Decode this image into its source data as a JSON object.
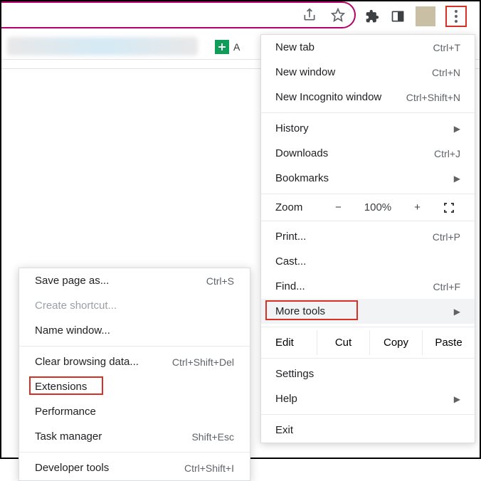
{
  "toolbar": {
    "tab_partial_label": "A"
  },
  "main_menu": {
    "new_tab": "New tab",
    "new_tab_sc": "Ctrl+T",
    "new_window": "New window",
    "new_window_sc": "Ctrl+N",
    "incognito": "New Incognito window",
    "incognito_sc": "Ctrl+Shift+N",
    "history": "History",
    "downloads": "Downloads",
    "downloads_sc": "Ctrl+J",
    "bookmarks": "Bookmarks",
    "zoom_label": "Zoom",
    "zoom_value": "100%",
    "print": "Print...",
    "print_sc": "Ctrl+P",
    "cast": "Cast...",
    "find": "Find...",
    "find_sc": "Ctrl+F",
    "more_tools": "More tools",
    "edit": "Edit",
    "cut": "Cut",
    "copy": "Copy",
    "paste": "Paste",
    "settings": "Settings",
    "help": "Help",
    "exit": "Exit"
  },
  "sub_menu": {
    "save_page": "Save page as...",
    "save_page_sc": "Ctrl+S",
    "create_shortcut": "Create shortcut...",
    "name_window": "Name window...",
    "clear_data": "Clear browsing data...",
    "clear_data_sc": "Ctrl+Shift+Del",
    "extensions": "Extensions",
    "performance": "Performance",
    "task_manager": "Task manager",
    "task_manager_sc": "Shift+Esc",
    "developer_tools": "Developer tools",
    "developer_tools_sc": "Ctrl+Shift+I"
  }
}
